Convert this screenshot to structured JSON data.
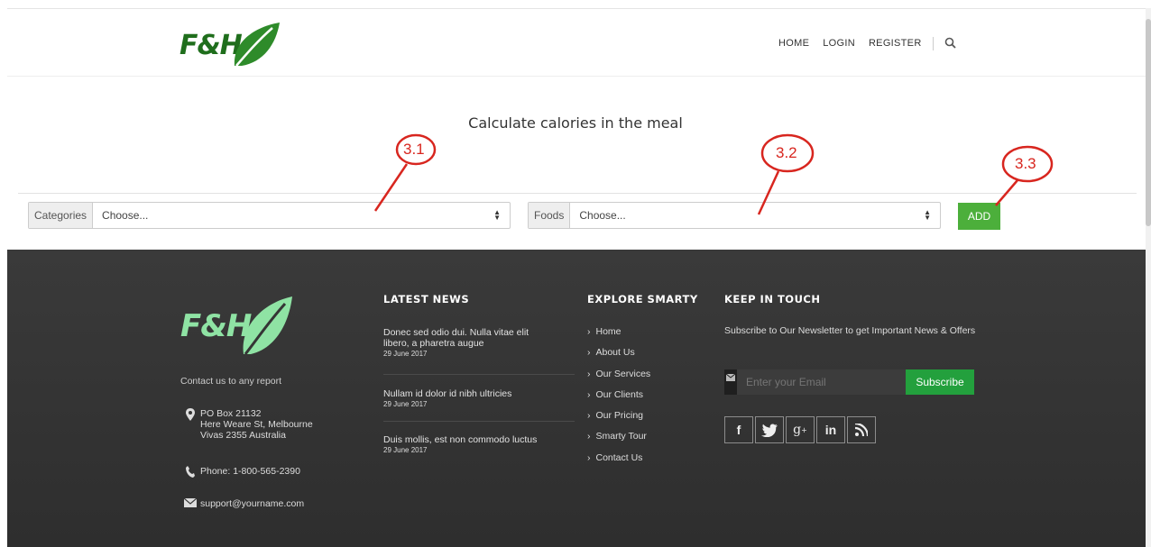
{
  "header": {
    "logo_text": "F&H",
    "nav": [
      "HOME",
      "LOGIN",
      "REGISTER"
    ]
  },
  "calculator": {
    "title": "Calculate calories in the meal",
    "categories": {
      "label": "Categories",
      "value": "Choose..."
    },
    "foods": {
      "label": "Foods",
      "value": "Choose..."
    },
    "add_label": "ADD"
  },
  "annotations": [
    "3.1",
    "3.2",
    "3.3"
  ],
  "footer": {
    "logo_text": "F&H",
    "contact_heading": "Contact us to any report",
    "address": [
      "PO Box 21132",
      "Here Weare St, Melbourne",
      "Vivas 2355 Australia"
    ],
    "phone": "Phone: 1-800-565-2390",
    "email": "support@yourname.com",
    "news_title": "LATEST NEWS",
    "news": [
      {
        "title": "Donec sed odio dui. Nulla vitae elit libero, a pharetra augue",
        "date": "29 June 2017"
      },
      {
        "title": "Nullam id dolor id nibh ultricies",
        "date": "29 June 2017"
      },
      {
        "title": "Duis mollis, est non commodo luctus",
        "date": "29 June 2017"
      }
    ],
    "explore_title": "EXPLORE SMARTY",
    "explore": [
      "Home",
      "About Us",
      "Our Services",
      "Our Clients",
      "Our Pricing",
      "Smarty Tour",
      "Contact Us"
    ],
    "keep_title": "KEEP IN TOUCH",
    "keep_text": "Subscribe to Our Newsletter to get Important News & Offers",
    "email_placeholder": "Enter your Email",
    "subscribe_label": "Subscribe",
    "social": [
      "f",
      "t",
      "g+",
      "in",
      "rss"
    ]
  },
  "colors": {
    "brand_green": "#1f6e1c",
    "button_green": "#4caf3b",
    "subscribe_green": "#23a03d",
    "annotation_red": "#d8261f",
    "footer_bg": "#353535"
  }
}
